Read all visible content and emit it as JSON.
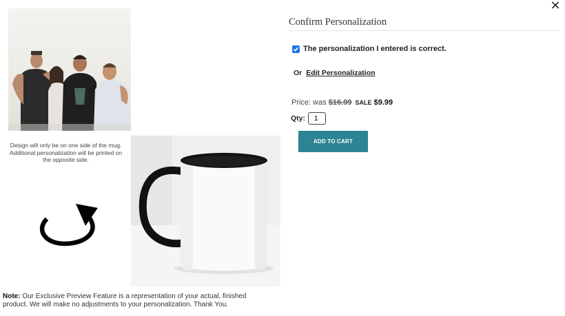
{
  "dialog": {
    "close_label": "×"
  },
  "preview": {
    "design_note": "Design will only be on one side of the mug. Additional personalization will be printed on the opposite side.",
    "rotate_icon": "rotate-icon",
    "note_label": "Note:",
    "note_text": " Our Exclusive Preview Feature is a representation of your actual, finished product. We will make no adjustments to your personalization. Thank You."
  },
  "confirm": {
    "title": "Confirm Personalization",
    "checkbox_checked": true,
    "checkbox_label": "The personalization I entered is correct.",
    "or_label": "Or",
    "edit_link": "Edit Personalization"
  },
  "pricing": {
    "price_label": "Price: was",
    "was_price": "$16.99",
    "sale_tag": "SALE",
    "sale_price": "$9.99",
    "qty_label": "Qty:",
    "qty_value": "1",
    "add_to_cart": "ADD TO CART"
  },
  "colors": {
    "accent": "#2d8494",
    "checkbox": "#1a73e8"
  }
}
